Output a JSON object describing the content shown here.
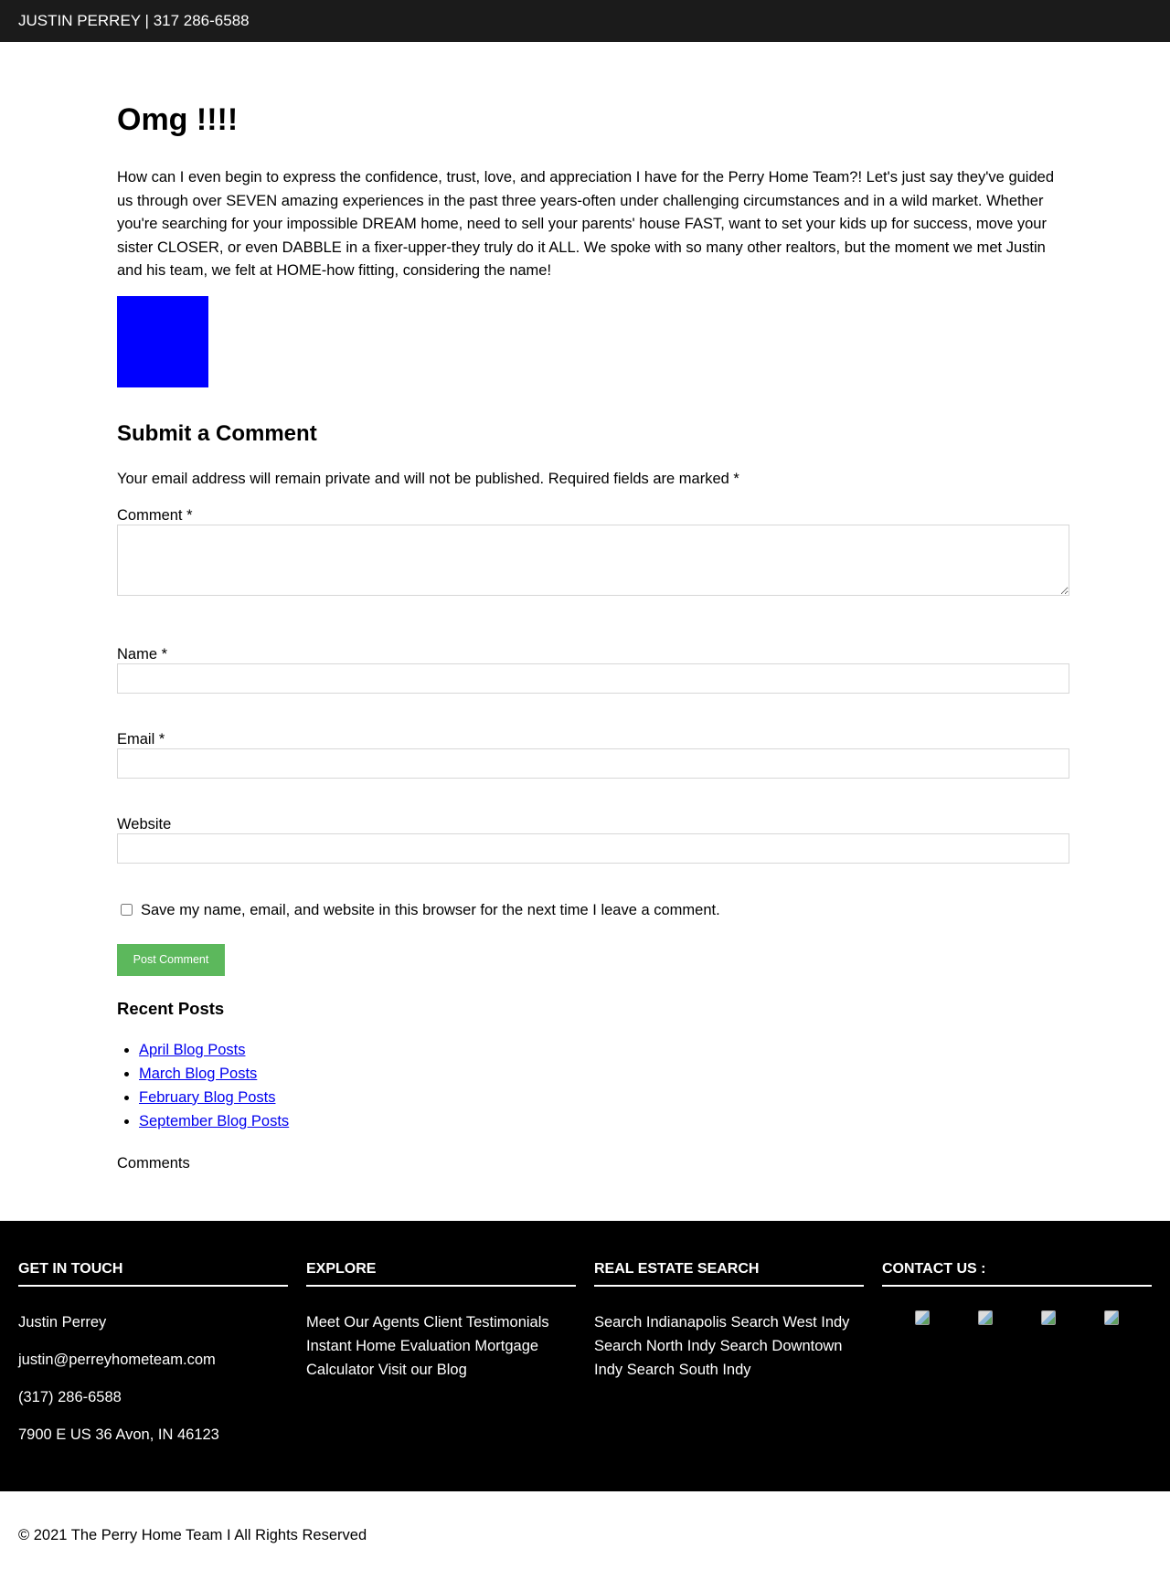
{
  "topbar": {
    "text": "JUSTIN PERREY | 317 286-6588"
  },
  "post": {
    "title": "Omg !!!!",
    "body": "How can I even begin to express the confidence, trust, love, and appreciation I have for the Perry Home Team?! Let's just say they've guided us through over SEVEN amazing experiences in the past three years-often under challenging circumstances and in a wild market. Whether you're searching for your impossible DREAM home, need to sell your parents' house FAST, want to set your kids up for success, move your sister CLOSER, or even DABBLE in a fixer-upper-they truly do it ALL. We spoke with so many other realtors, but the moment we met Justin and his team, we felt at HOME-how fitting, considering the name!",
    "image_color": "#0000ff"
  },
  "comment_form": {
    "title": "Submit a Comment",
    "note": "Your email address will remain private and will not be published. Required fields are marked *",
    "comment_label": "Comment *",
    "name_label": "Name *",
    "email_label": "Email *",
    "website_label": "Website",
    "cookie_label": "Save my name, email, and website in this browser for the next time I leave a comment.",
    "submit_label": "Post Comment",
    "submit_color": "#5cb85c"
  },
  "recent_posts": {
    "title": "Recent Posts",
    "items": [
      {
        "label": "April Blog Posts"
      },
      {
        "label": "March Blog Posts"
      },
      {
        "label": "February Blog Posts"
      },
      {
        "label": "September Blog Posts"
      }
    ],
    "comments_label": "Comments"
  },
  "footer": {
    "get_in_touch": {
      "title": "GET IN TOUCH",
      "name": "Justin Perrey",
      "email": "justin@perreyhometeam.com",
      "phone": "(317) 286-6588",
      "address": "7900 E US 36 Avon, IN 46123"
    },
    "explore": {
      "title": "EXPLORE",
      "links": "Meet Our Agents Client Testimonials Instant Home Evaluation Mortgage Calculator Visit our Blog"
    },
    "search": {
      "title": "REAL ESTATE SEARCH",
      "links": "Search Indianapolis Search West Indy Search North Indy Search Downtown Indy Search South Indy"
    },
    "contact": {
      "title": "CONTACT US :",
      "icons": [
        "broken-image-icon",
        "broken-image-icon",
        "broken-image-icon",
        "broken-image-icon"
      ]
    }
  },
  "copyright": "© 2021 The Perry Home Team I All Rights Reserved"
}
